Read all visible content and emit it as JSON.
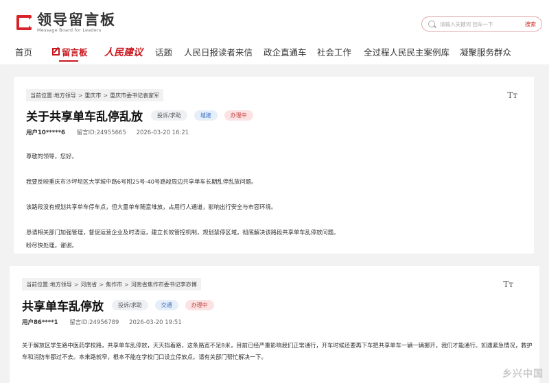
{
  "header": {
    "logo_cn": "领导留言板",
    "logo_en": "Message Board for Leaders",
    "search": {
      "placeholder": "请输入关键词 回车一下",
      "button": "搜索"
    }
  },
  "nav": [
    {
      "label": "首页"
    },
    {
      "label": "留言板",
      "active": true
    },
    {
      "label": "人民建议"
    },
    {
      "label": "话题"
    },
    {
      "label": "人民日报读者来信"
    },
    {
      "label": "政企直通车"
    },
    {
      "label": "社会工作"
    },
    {
      "label": "全过程人民民主案例库"
    },
    {
      "label": "凝聚服务群众"
    }
  ],
  "font_toggle": "Tт",
  "messages": [
    {
      "breadcrumb_label": "当前位置:",
      "breadcrumb": [
        "地方领导",
        "重庆市",
        "重庆市委书记袁家军"
      ],
      "title": "关于共享单车乱停乱放",
      "tags": [
        "投诉/求助",
        "城建",
        "办理中"
      ],
      "user": "用户10*****6",
      "message_id": "留言ID:24955665",
      "time": "2026-03-20 16:21",
      "body": [
        "尊敬的领导，您好。",
        "我要反映重庆市沙坪坝区大学城中路6号附25号-40号路段周边共享单车长期乱停乱放问题。",
        "该路段没有规划共享单车停车点，但大量单车随意堆放，占用行人通道，影响出行安全与市容环境。",
        "恳请相关部门加强管理，督促运营企业及时清运，建立长效管控机制，规划禁停区域，彻底解决该路段共享单车乱停放问题。",
        "盼尽快处理，谢谢。"
      ]
    },
    {
      "breadcrumb_label": "当前位置:",
      "breadcrumb": [
        "地方领导",
        "河南省",
        "焦作市",
        "河南省焦作市委书记李亦博"
      ],
      "title": "共享单车乱停放",
      "tags": [
        "投诉/求助",
        "交通",
        "办理中"
      ],
      "user": "用户86****1",
      "message_id": "留言ID:24956789",
      "time": "2026-03-20 19:51",
      "body": [
        "关于解放区学生路中医药学校路，共享单车乱停放，天天挡着路，这条路宽不足8米，目前已经严重影响我们正常通行，开车时候还要再下车把共享单车一辆一辆挪开，我们才能通行。如遇紧急情况，救护车和消防车都过不去。本来路就窄，根本不能在学校门口设立停放点。请有关部门帮忙解决一下。"
      ]
    }
  ],
  "watermark": "乡兴中国"
}
